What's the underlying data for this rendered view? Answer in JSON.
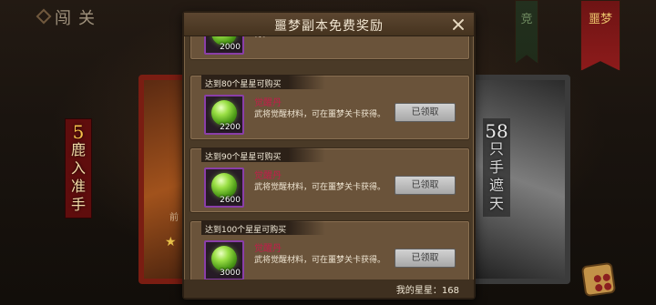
{
  "background": {
    "top_left_label": "闯关",
    "banners": [
      "竞",
      "噩梦"
    ],
    "left_tag": {
      "number": "5",
      "text": "鹿入准手"
    },
    "right_tag": {
      "number": "58",
      "text": "只手遮天"
    },
    "card_label": "前"
  },
  "dialog": {
    "title": "噩梦副本免费奖励",
    "close_icon": "close-icon",
    "items": [
      {
        "requirement": "",
        "name": "",
        "desc": "得。",
        "quantity": "2000",
        "button": ""
      },
      {
        "requirement": "达到80个星星可购买",
        "name": "觉醒丹",
        "desc": "武将觉醒材料，可在噩梦关卡获得。",
        "quantity": "2200",
        "button": "已领取"
      },
      {
        "requirement": "达到90个星星可购买",
        "name": "觉醒丹",
        "desc": "武将觉醒材料，可在噩梦关卡获得。",
        "quantity": "2600",
        "button": "已领取"
      },
      {
        "requirement": "达到100个星星可购买",
        "name": "觉醒丹",
        "desc": "武将觉醒材料，可在噩梦关卡获得。",
        "quantity": "3000",
        "button": "已领取"
      }
    ],
    "footer": {
      "stars_label": "我的星星：168"
    }
  },
  "colors": {
    "item_name": "#c21d4a",
    "icon_border": "#8a3ea8",
    "claimed_button": "#c0c0c0"
  }
}
